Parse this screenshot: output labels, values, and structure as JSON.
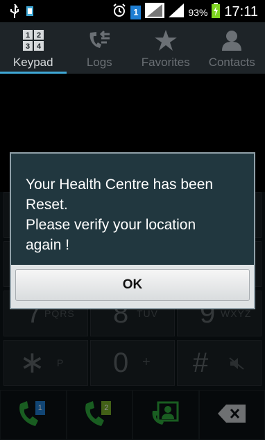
{
  "status_bar": {
    "battery_percent": "93%",
    "time": "17:11",
    "sim_badge": "1",
    "icons": [
      "usb-icon",
      "sim-card-icon",
      "alarm-icon",
      "sim1-badge-icon",
      "signal-icon",
      "signal-icon",
      "battery-charging-icon"
    ]
  },
  "tabs": [
    {
      "label": "Keypad",
      "icon": "keypad-icon",
      "active": true
    },
    {
      "label": "Logs",
      "icon": "logs-icon",
      "active": false
    },
    {
      "label": "Favorites",
      "icon": "star-icon",
      "active": false
    },
    {
      "label": "Contacts",
      "icon": "person-icon",
      "active": false
    }
  ],
  "tab_icon_text": {
    "keypad_digits": [
      "1",
      "2",
      "3",
      "4"
    ]
  },
  "keypad": {
    "row3": [
      {
        "digit": "7",
        "letters": "PQRS"
      },
      {
        "digit": "8",
        "letters": "TUV"
      },
      {
        "digit": "9",
        "letters": "WXYZ"
      }
    ],
    "row4": [
      {
        "digit": "∗",
        "letters": "P"
      },
      {
        "digit": "0",
        "letters": "+"
      },
      {
        "digit": "#",
        "letters": ""
      }
    ]
  },
  "bottom_bar": {
    "call_sim1_badge": "1",
    "call_sim2_badge": "2",
    "icons": [
      "call-sim1-icon",
      "call-sim2-icon",
      "add-contact-icon",
      "backspace-icon"
    ]
  },
  "dialog": {
    "message_line1": "Your Health Centre has been",
    "message_line2": "Reset.",
    "message_line3": "Please verify your location",
    "message_line4": "again !",
    "ok_label": "OK"
  },
  "colors": {
    "dialog_bg": "#21373f",
    "tab_active_underline": "#3fa8d6",
    "call_green": "#2eaa3c",
    "sim1_blue": "#1f7fd4",
    "sim2_green": "#78b02a"
  }
}
